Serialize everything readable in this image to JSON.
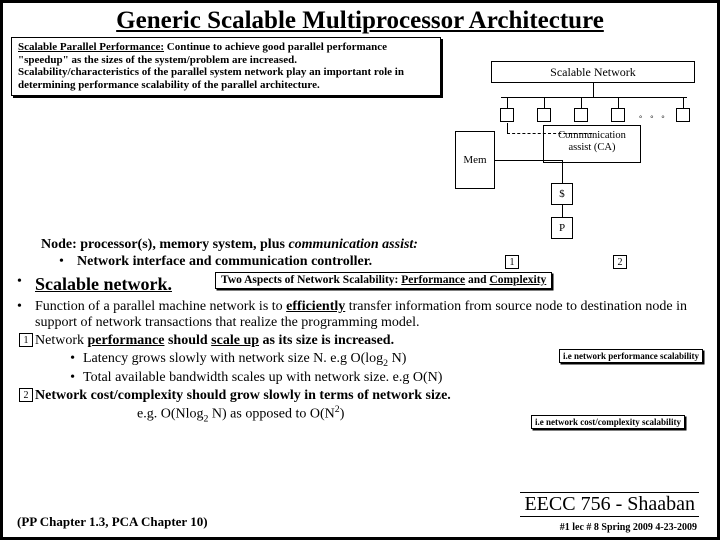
{
  "title": "Generic Scalable Multiprocessor Architecture",
  "topbox": {
    "lead": "Scalable Parallel Performance:",
    "rest1": "Continue to achieve good parallel performance",
    "rest2": "\"speedup\" as the sizes of the system/problem are increased.",
    "rest3": "Scalability/characteristics of the parallel system network play an important role in determining performance scalability of the parallel architecture."
  },
  "diagram": {
    "network": "Scalable    Network",
    "mem": "Mem",
    "ca": "Communication\nassist (CA)",
    "dollar": "$",
    "p": "P",
    "dots": "° ° °"
  },
  "body": {
    "node_heading": "Node: processor(s), memory system, plus ",
    "node_tail": "communication assist:",
    "node_sub": "Network interface and communication controller.",
    "n1": "1",
    "n2": "2",
    "scalable_network": "Scalable network.",
    "two_aspects_pre": "Two Aspects of Network Scalability: ",
    "two_aspects_a": "Performance",
    "two_aspects_and": " and ",
    "two_aspects_b": "Complexity",
    "func1a": "Function of a parallel machine network is to ",
    "func1b": "efficiently",
    "func1c": " transfer information from source node to destination node in support of network transactions that realize the programming model.",
    "perf1": "Network ",
    "perf2": "performance",
    "perf3": " should ",
    "perf4": "scale up",
    "perf5": " as its size is increased.",
    "side1": "i.e network performance scalability",
    "lat_a": "Latency grows slowly with network size N.  e.g O(log",
    "lat_b": " N)",
    "bw": "Total available bandwidth scales up with network size.  e.g O(N)",
    "cost": "Network cost/complexity should grow slowly in terms of network size.",
    "cost2a": "e.g. O(Nlog",
    "cost2b": " N)  as opposed to O(N",
    "cost2c": ")",
    "side2": "i.e network cost/complexity scalability"
  },
  "footer": {
    "ref": "(PP Chapter 1.3,  PCA Chapter 10)",
    "course": "EECC 756 - Shaaban",
    "meta": "#1  lec # 8    Spring 2009  4-23-2009"
  }
}
